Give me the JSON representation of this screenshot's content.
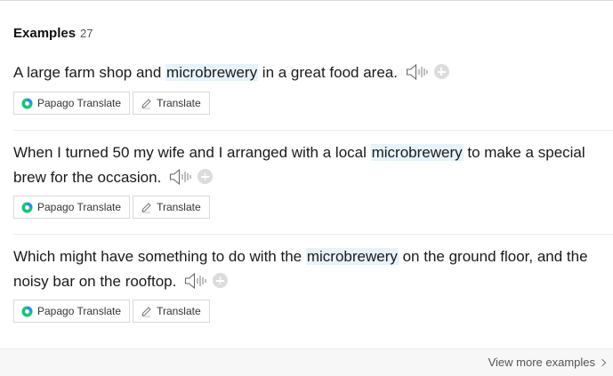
{
  "header": {
    "title": "Examples",
    "count": "27"
  },
  "examples": [
    {
      "before": "A large farm shop and ",
      "highlight": "microbrewery",
      "after": " in a great food area.",
      "papago_label": "Papago Translate",
      "translate_label": "Translate"
    },
    {
      "before": "When I turned 50 my wife and I arranged with a local ",
      "highlight": "microbrewery",
      "after": " to make a special brew for the occasion.",
      "papago_label": "Papago Translate",
      "translate_label": "Translate"
    },
    {
      "before": "Which might have something to do with the ",
      "highlight": "microbrewery",
      "after": " on the ground floor, and the noisy bar on the rooftop.",
      "papago_label": "Papago Translate",
      "translate_label": "Translate"
    }
  ],
  "footer": {
    "view_more": "View more examples"
  },
  "colors": {
    "highlight": "#e8f2fb",
    "papago_green": "#19c37d",
    "papago_blue": "#2a8bf2"
  }
}
